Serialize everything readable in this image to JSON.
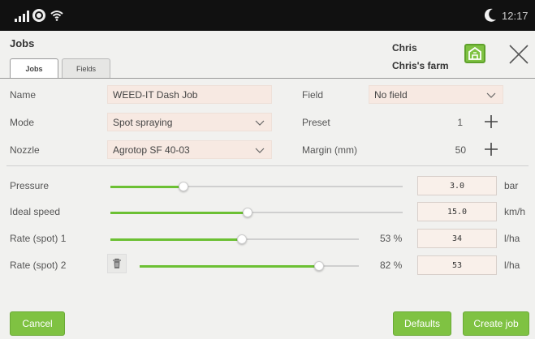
{
  "status_bar": {
    "time": "12:17",
    "icons": [
      "signal-icon",
      "location-icon",
      "wifi-icon",
      "night-mode-icon"
    ]
  },
  "header": {
    "title": "Jobs",
    "user": "Chris",
    "farm": "Chris's farm"
  },
  "tabs": [
    {
      "label": "Jobs",
      "active": true
    },
    {
      "label": "Fields",
      "active": false
    }
  ],
  "form": {
    "name_label": "Name",
    "name_value": "WEED-IT Dash Job",
    "mode_label": "Mode",
    "mode_value": "Spot spraying",
    "nozzle_label": "Nozzle",
    "nozzle_value": "Agrotop SF 40-03",
    "field_label": "Field",
    "field_value": "No field",
    "preset_label": "Preset",
    "preset_value": "1",
    "margin_label": "Margin (mm)",
    "margin_value": "50"
  },
  "sliders": [
    {
      "label": "Pressure",
      "value": "3.0",
      "unit": "bar",
      "fraction": 0.25
    },
    {
      "label": "Ideal speed",
      "value": "15.0",
      "unit": "km/h",
      "fraction": 0.47
    },
    {
      "label": "Rate (spot) 1",
      "value": "34",
      "unit": "l/ha",
      "percent": "53 %",
      "fraction": 0.53
    },
    {
      "label": "Rate (spot) 2",
      "value": "53",
      "unit": "l/ha",
      "percent": "82 %",
      "fraction": 0.82
    }
  ],
  "footer": {
    "cancel_label": "Cancel",
    "defaults_label": "Defaults",
    "create_label": "Create job"
  },
  "colors": {
    "accent": "#7fc242",
    "slider_fill": "#6cc033",
    "input_bg": "#f7e9e2",
    "status_bar_bg": "#111111"
  }
}
